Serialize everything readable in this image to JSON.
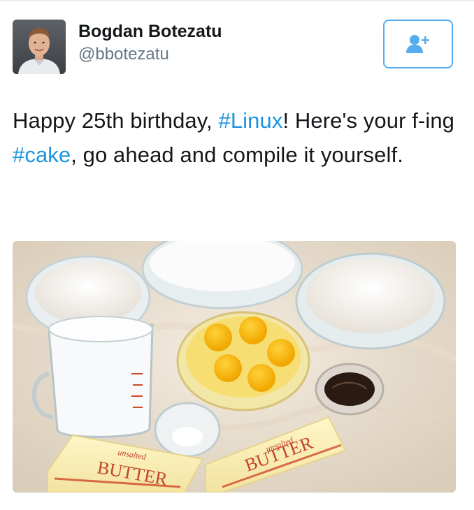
{
  "tweet": {
    "author": {
      "display_name": "Bogdan Botezatu",
      "handle": "@bbotezatu"
    },
    "follow_button": {
      "icon": "follow-user-icon",
      "accent": "#55acee"
    },
    "text": {
      "part1": "Happy 25th birthday, ",
      "hashtag1": "#Linux",
      "part2": "! Here's your f-ing ",
      "hashtag2": "#cake",
      "part3": ", go ahead and compile it yourself."
    },
    "media": {
      "butter_left": {
        "brand": "BUTTER",
        "sub": "unsalted"
      },
      "butter_right": {
        "brand": "BUTTER",
        "sub": "unsalted"
      }
    }
  },
  "colors": {
    "hashtag": "#1b95e0",
    "text": "#14171a",
    "secondary": "#657786"
  }
}
